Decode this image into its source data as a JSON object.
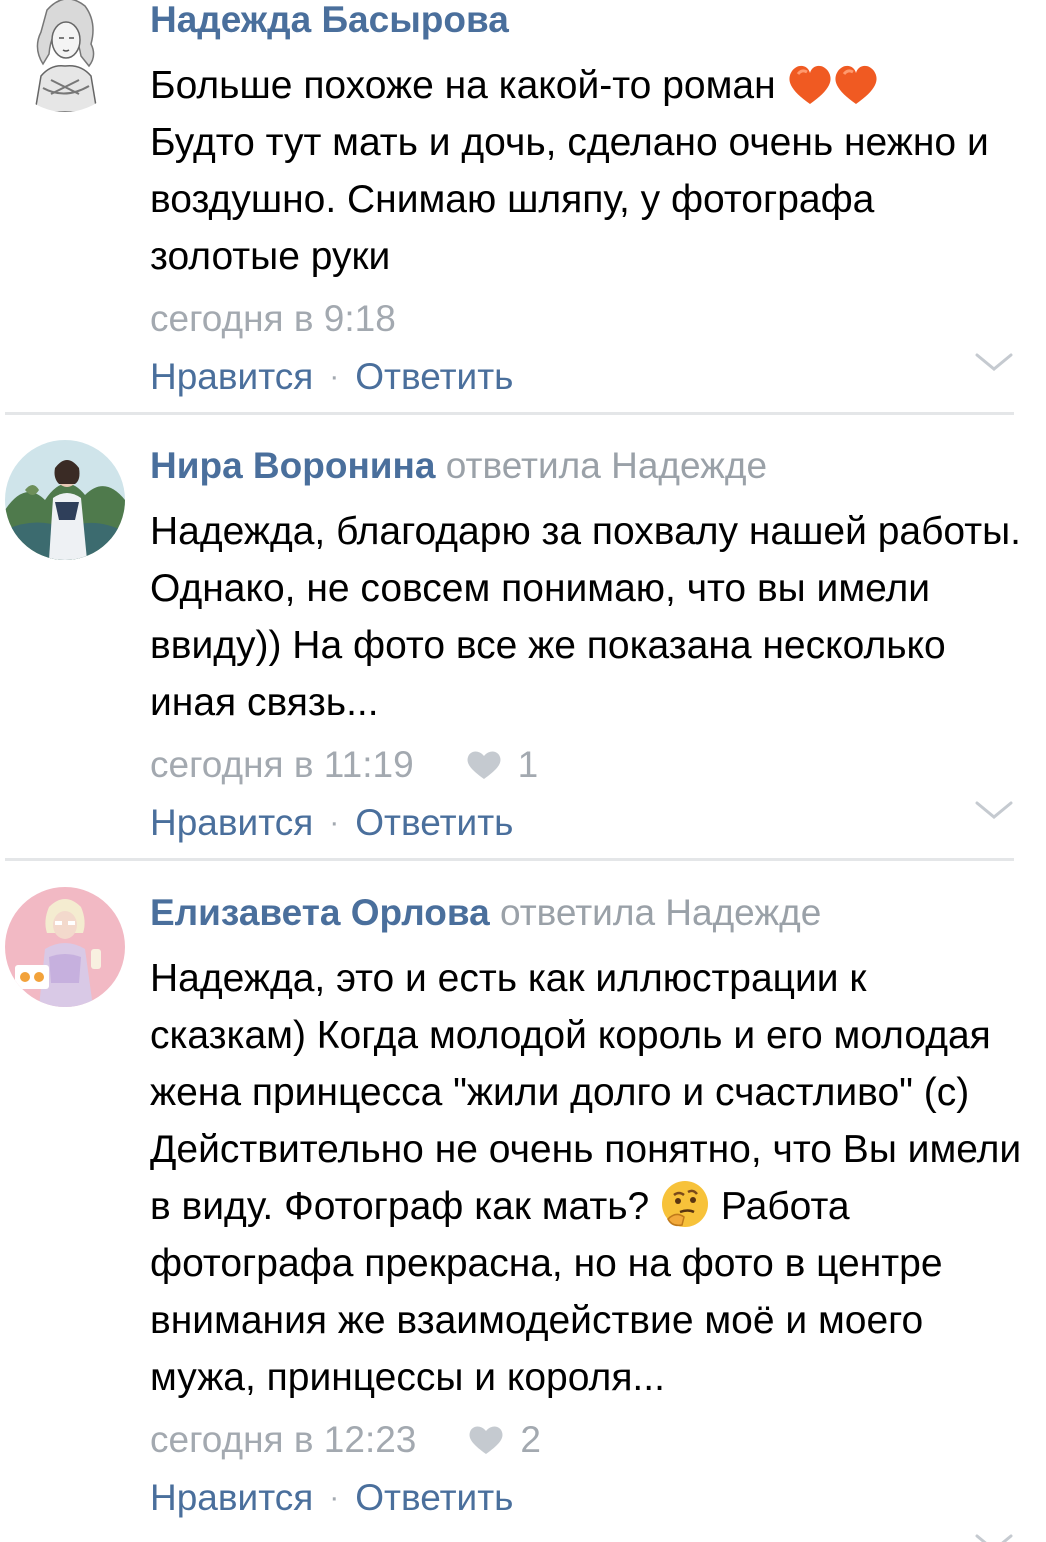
{
  "comments": [
    {
      "author": "Надежда Басырова",
      "replied": "",
      "paragraphs": [
        "Больше похоже на какой-то роман",
        "Будто тут мать и дочь, сделано очень нежно и воздушно. Снимаю шляпу, у фотографа золотые руки"
      ],
      "emoji": "two-hearts-emoji",
      "time": "сегодня в 9:18",
      "likes": "",
      "like_label": "Нравится",
      "reply_label": "Ответить"
    },
    {
      "author": "Нира Воронина",
      "replied": "ответила Надежде",
      "paragraphs": [
        "Надежда, благодарю за похвалу нашей работы. Однако, не совсем понимаю, что вы имели ввиду)) На фото все же показана несколько иная связь..."
      ],
      "time": "сегодня в 11:19",
      "likes": "1",
      "like_label": "Нравится",
      "reply_label": "Ответить"
    },
    {
      "author": "Елизавета Орлова",
      "replied": "ответила Надежде",
      "paragraphs": [
        "Надежда, это и есть как иллюстрации к сказкам) Когда молодой король и его молодая жена принцесса \"жили долго и счастливо\" (с)",
        "Действительно не очень понятно, что Вы имели в виду. Фотограф как мать?",
        "Работа фотографа прекрасна, но на фото в центре внимания же взаимодействие моё и моего мужа, принцессы и короля..."
      ],
      "emoji": "thinking-face-emoji",
      "time": "сегодня в 12:23",
      "likes": "2",
      "like_label": "Нравится",
      "reply_label": "Ответить"
    }
  ],
  "colors": {
    "link": "#4a6f9c",
    "muted": "#a3a9b0",
    "divider": "#e4e6e8",
    "heart": "#f05a22"
  }
}
